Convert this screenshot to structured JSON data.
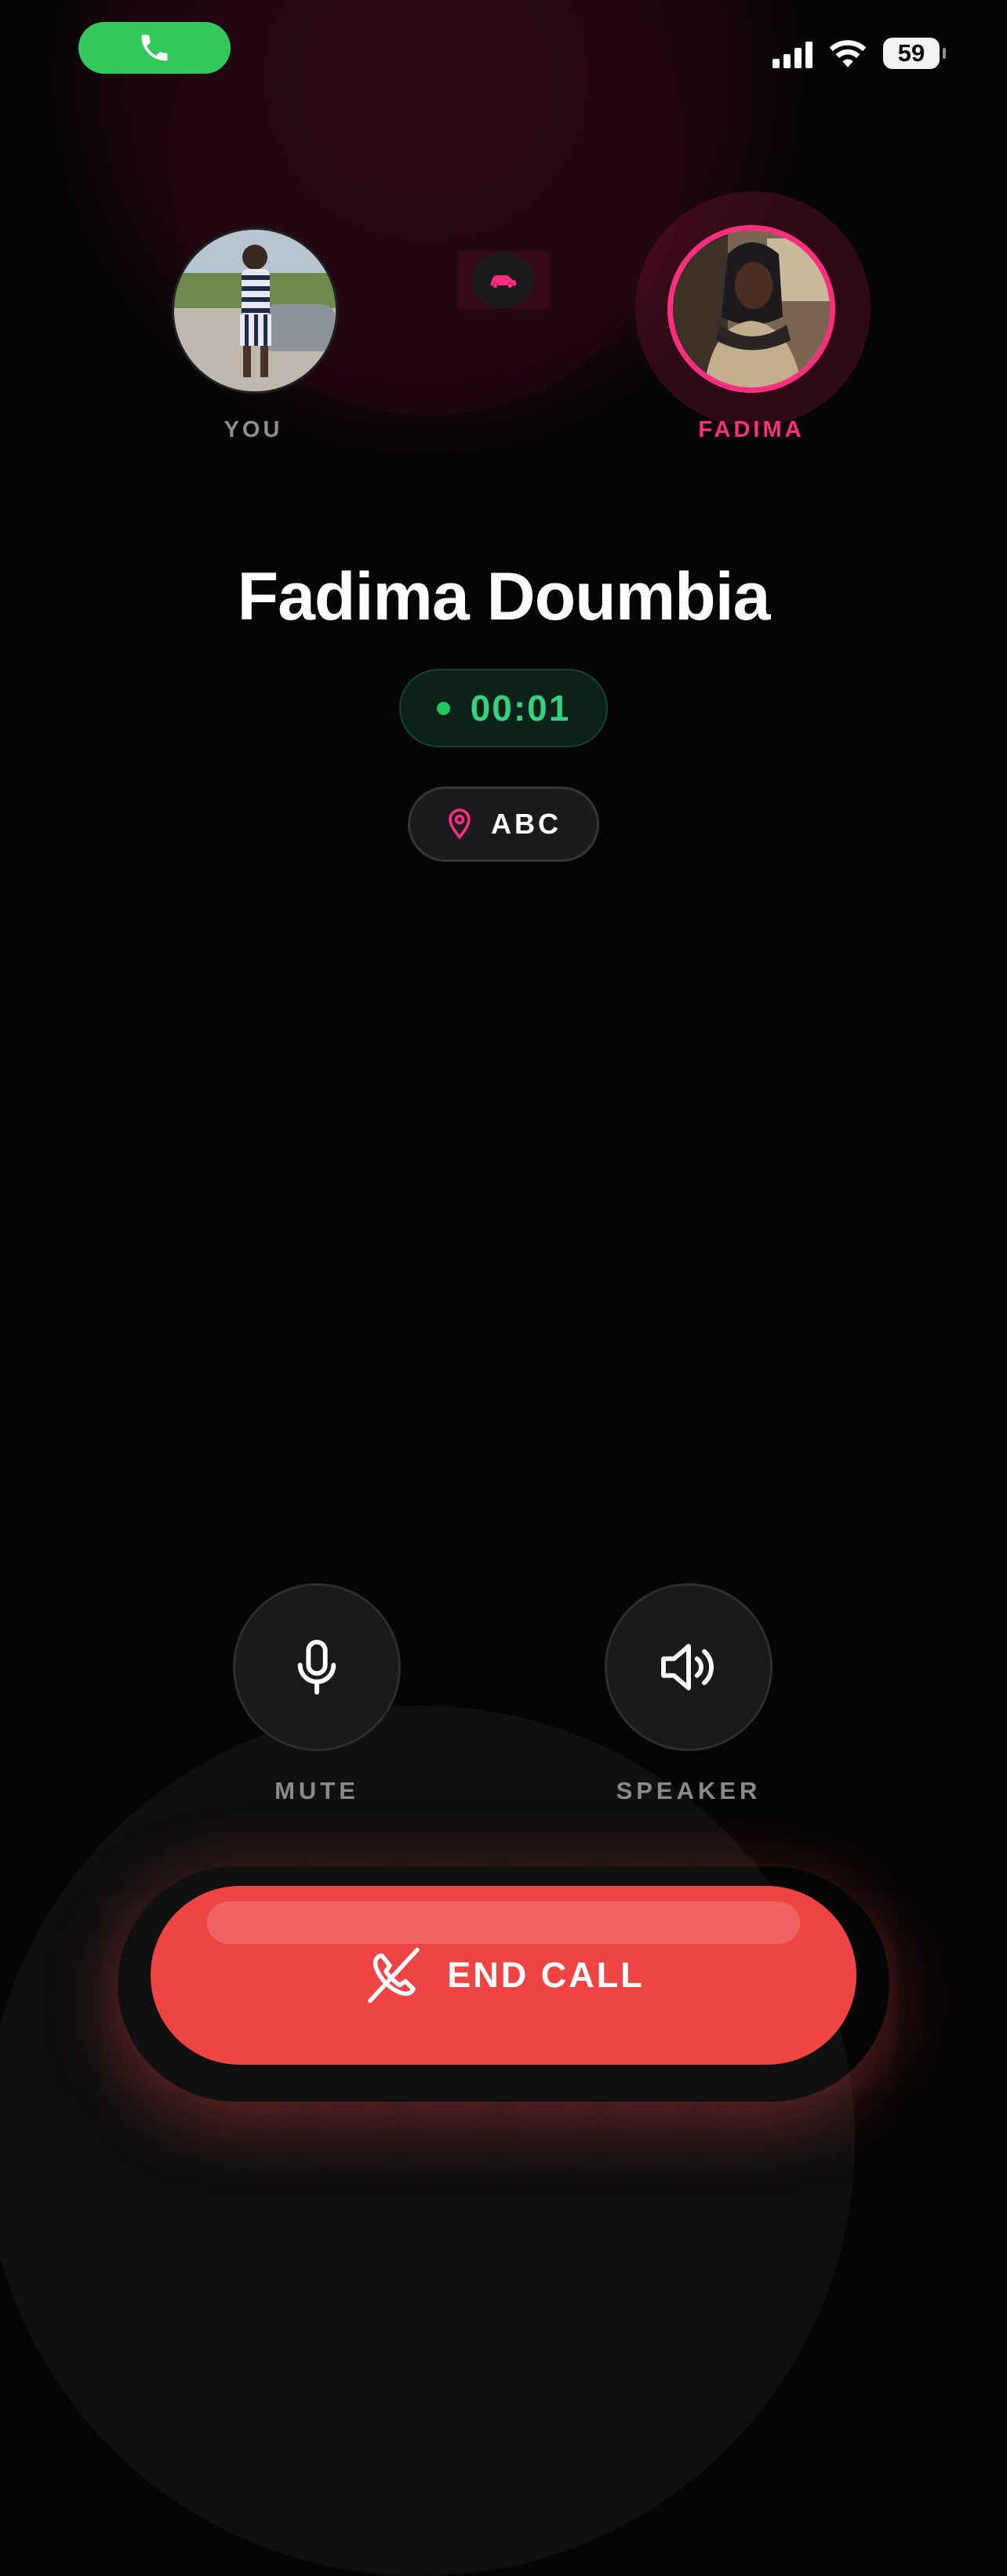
{
  "status_bar": {
    "battery": "59"
  },
  "participants": {
    "you": {
      "label": "YOU"
    },
    "other": {
      "label": "FADIMA"
    }
  },
  "contact": {
    "name": "Fadima Doumbia"
  },
  "call": {
    "timer": "00:01",
    "location": "ABC"
  },
  "controls": {
    "mute_label": "MUTE",
    "speaker_label": "SPEAKER"
  },
  "end_call": {
    "label": "END CALL"
  },
  "colors": {
    "accent_pink": "#ff2e7e",
    "timer_green": "#34d17f",
    "end_red": "#ef4444",
    "call_pill": "#34c759"
  }
}
